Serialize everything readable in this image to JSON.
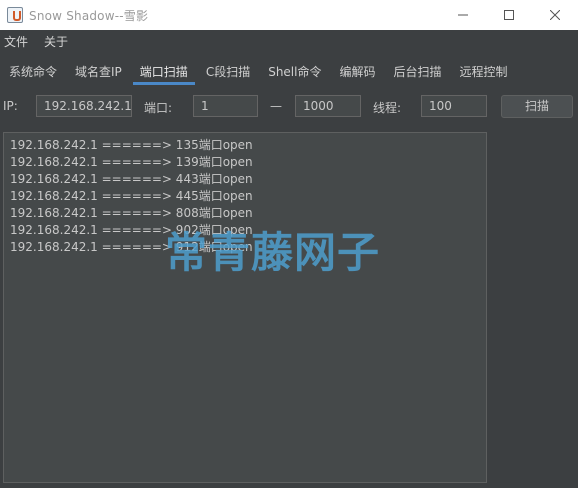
{
  "window": {
    "title": "Snow Shadow--雪影",
    "minimize_glyph": "—",
    "maximize_glyph": "☐",
    "close_glyph": "✕"
  },
  "menu": [
    "文件",
    "关于"
  ],
  "tabs": [
    {
      "label": "系统命令",
      "active": false
    },
    {
      "label": "域名查IP",
      "active": false
    },
    {
      "label": "端口扫描",
      "active": true
    },
    {
      "label": "C段扫描",
      "active": false
    },
    {
      "label": "Shell命令",
      "active": false
    },
    {
      "label": "编解码",
      "active": false
    },
    {
      "label": "后台扫描",
      "active": false
    },
    {
      "label": "远程控制",
      "active": false
    }
  ],
  "scan": {
    "ip_label": "IP:",
    "ip_value": "192.168.242.1",
    "port_label": "端口:",
    "port_start": "1",
    "dash": "—",
    "port_end": "1000",
    "thread_label": "线程:",
    "thread_value": "100",
    "scan_button": "扫描"
  },
  "output_lines": [
    "192.168.242.1 ======> 135端口open",
    "192.168.242.1 ======> 139端口open",
    "192.168.242.1 ======> 443端口open",
    "192.168.242.1 ======> 445端口open",
    "192.168.242.1 ======> 808端口open",
    "192.168.242.1 ======> 902端口open",
    "192.168.242.1 ======> 912端口open"
  ],
  "watermark": "常青藤网子",
  "colors": {
    "background": "#3c3f41",
    "field_bg": "#45494a",
    "accent": "#4a88c7",
    "watermark": "#4e9ecd"
  }
}
